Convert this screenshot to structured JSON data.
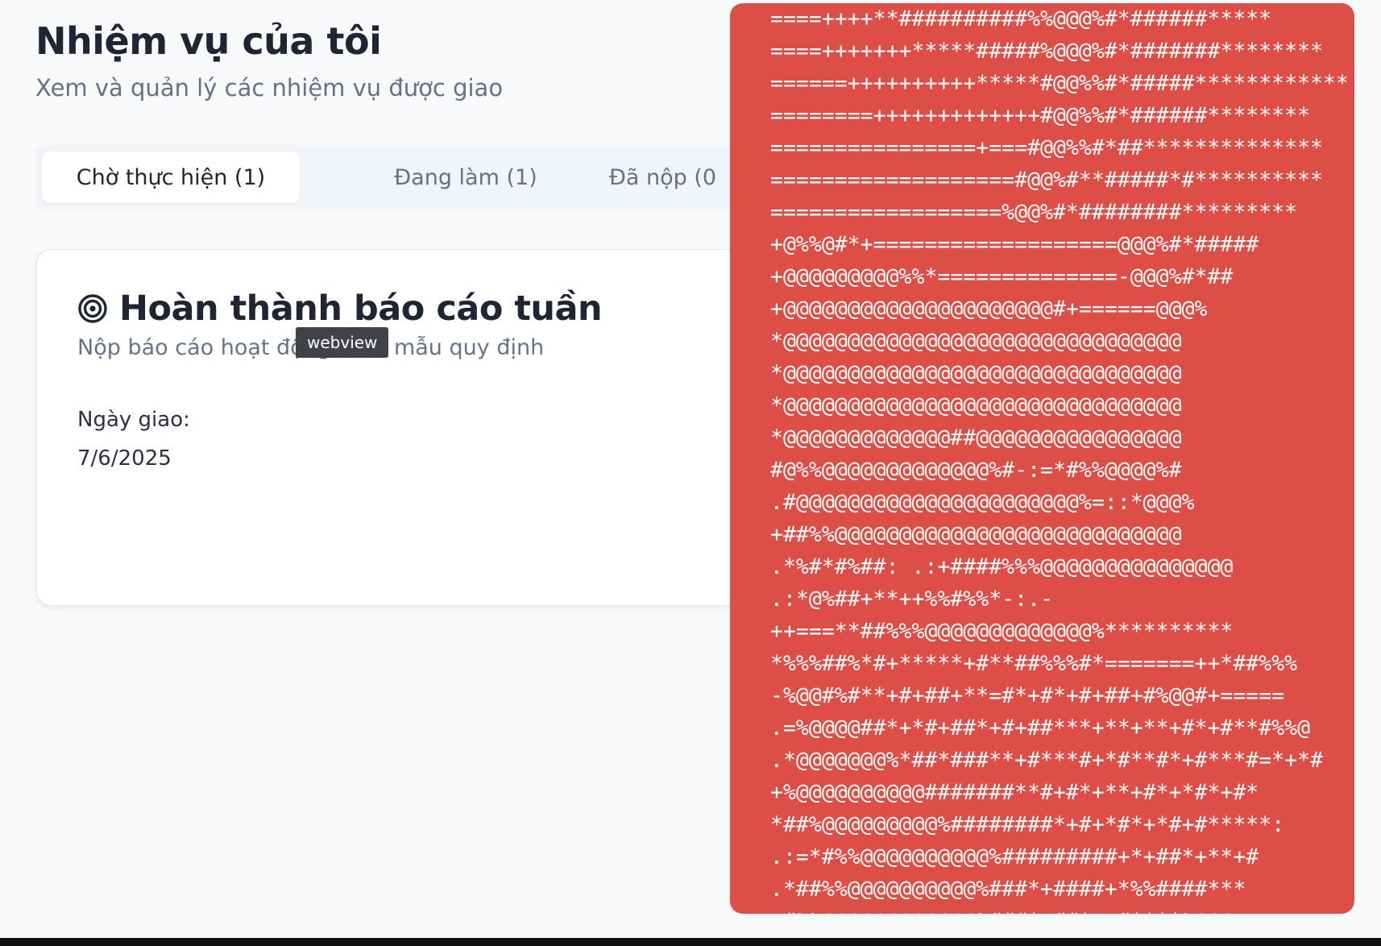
{
  "header": {
    "title": "Nhiệm vụ của tôi",
    "subtitle": "Xem và quản lý các nhiệm vụ được giao"
  },
  "tabs": [
    {
      "label": "Chờ thực hiện (1)",
      "active": true
    },
    {
      "label": "Đang làm (1)",
      "active": false
    },
    {
      "label": "Đã nộp (0",
      "active": false
    }
  ],
  "task_card": {
    "icon": "target-icon",
    "title": "Hoàn thành báo cáo tuần",
    "description": "Nộp báo cáo hoạt động theo mẫu quy định",
    "assigned_label": "Ngày giao:",
    "assigned_date": "7/6/2025"
  },
  "tooltip": {
    "text": "webview"
  },
  "overlay": {
    "background_color": "#dd4e47",
    "ascii_art": "====++++**##########%%@@@%#*######*****\n====+++++++*****#####%@@@%#*#######********\n======++++++++++*****#@@%%#*#####************\n========+++++++++++++#@@%%#*######********\n================+===#@@%%#*##**************\n===================#@@%#**#####*#**********\n==================%@@%#*########*********\n+@%%@#*+===================@@@%#*#####\n+@@@@@@@@@%%*==============-@@@%#*##\n+@@@@@@@@@@@@@@@@@@@@@#+======@@@%\n*@@@@@@@@@@@@@@@@@@@@@@@@@@@@@@@\n*@@@@@@@@@@@@@@@@@@@@@@@@@@@@@@@\n*@@@@@@@@@@@@@@@@@@@@@@@@@@@@@@@\n*@@@@@@@@@@@@@##@@@@@@@@@@@@@@@@\n#@%%@@@@@@@@@@@@@%#-:=*#%%@@@@%#\n.#@@@@@@@@@@@@@@@@@@@@@@%=::*@@@%\n+##%%@@@@@@@@@@@@@@@@@@@@@@@@@@@\n.*%#*#%##: .:+####%%%@@@@@@@@@@@@@@@\n.:*@%##+**++%%#%%*-:.-\n++===**##%%%@@@@@@@@@@@@@%**********\n*%%%##%*#+*****+#**##%%%#*=======++*##%%%\n-%@@#%#**+#+##+**=#*+#*+#+##+#%@@#+=====\n.=%@@@@##*+*#+##*+#+##***+**+**+#*+#**#%%@\n.*@@@@@@@%*##*###**+#***#+*#**#*+#***#=*+*#\n+%@@@@@@@@@@#######**#+#*+**+#*+*#*+#*\n*##%@@@@@@@@@%########*+#+*#*+*#+#*****:\n.:=*#%%@@@@@@@@@@%#########+*+##*+**+#\n.*##%%@@@@@@@@@@%###*+####+*%%####***\n+#%%@@@@@@@@@@@@%###*+##*=+#****%@@@"
  }
}
